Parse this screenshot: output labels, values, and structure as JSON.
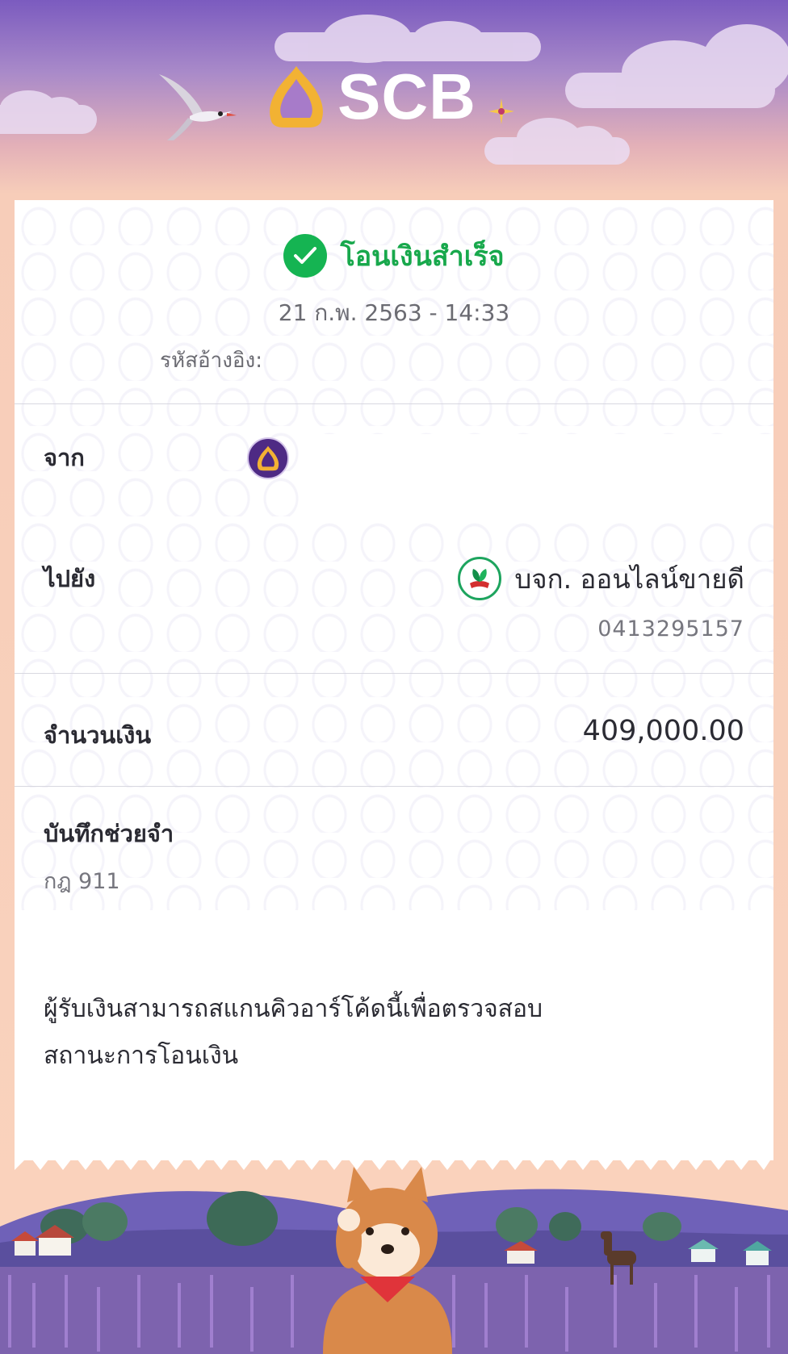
{
  "header": {
    "brand": "SCB",
    "colors": {
      "top": "#7b5bbf",
      "bottom": "#fad3bd",
      "logo_gold": "#f2b233"
    }
  },
  "status": {
    "icon": "check-circle-icon",
    "text": "โอนเงินสำเร็จ",
    "color": "#18a84c"
  },
  "datetime": "21 ก.พ. 2563 - 14:33",
  "reference": {
    "label": "รหัสอ้างอิง:"
  },
  "from": {
    "label": "จาก",
    "bank_icon": "scb-bank-icon"
  },
  "to": {
    "label": "ไปยัง",
    "bank_icon": "kbank-icon",
    "name": "บจก. ออนไลน์ขายดี",
    "account": "0413295157"
  },
  "amount": {
    "label": "จำนวนเงิน",
    "value": "409,000.00"
  },
  "memo": {
    "label": "บันทึกช่วยจำ",
    "value": "กฎ 911"
  },
  "qr_note": "ผู้รับเงินสามารถสแกนคิวอาร์โค้ดนี้เพื่อตรวจสอบสถานะการโอนเงิน"
}
